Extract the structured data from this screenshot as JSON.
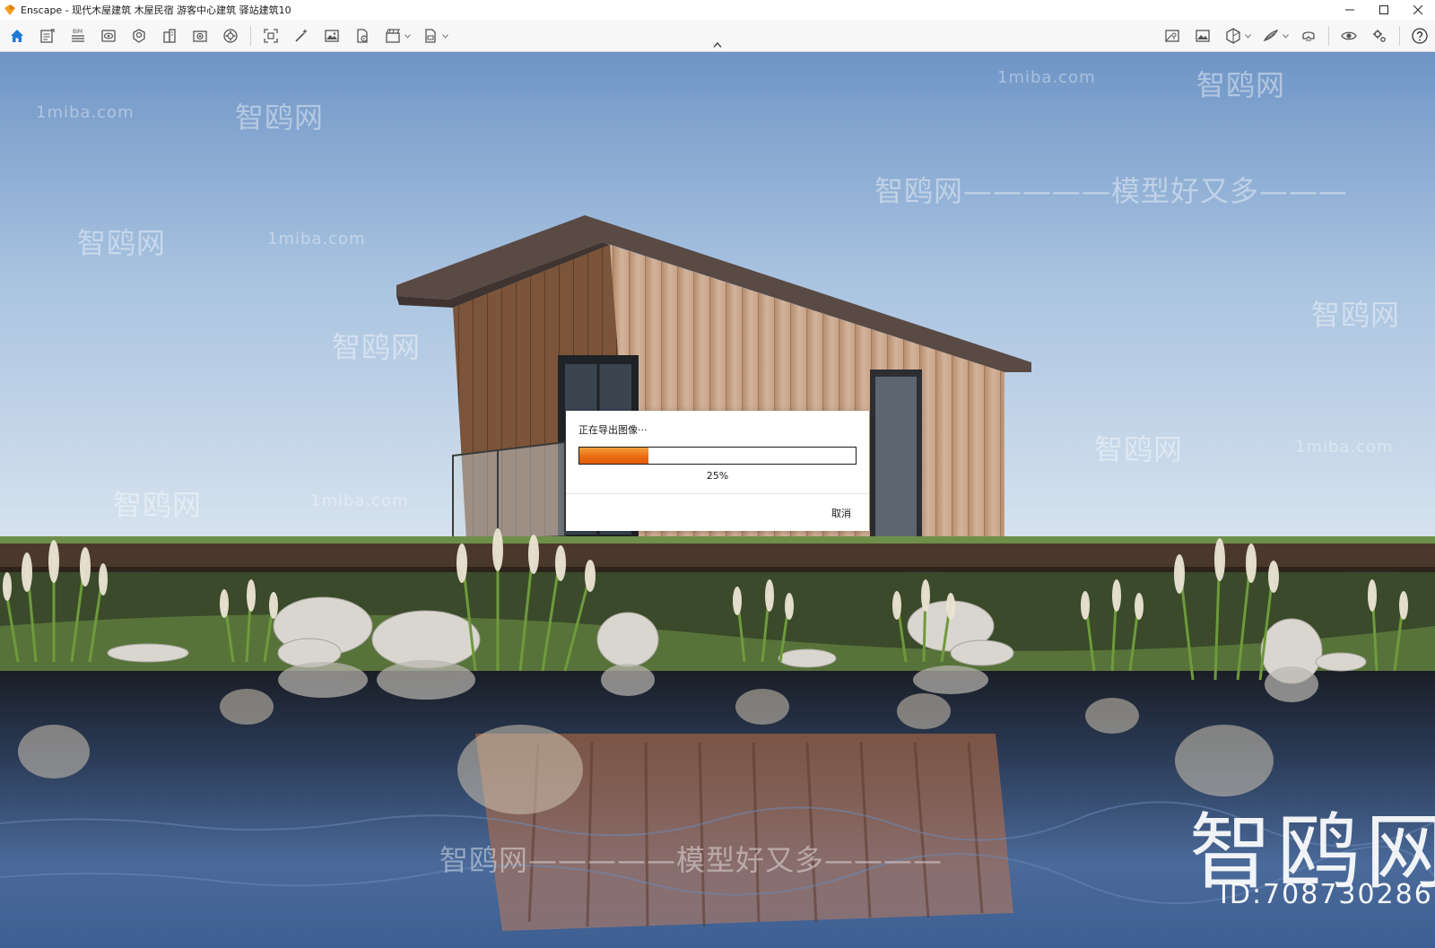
{
  "window": {
    "title": "Enscape - 现代木屋建筑 木屋民宿 游客中心建筑 驿站建筑10",
    "accent_color": "#1d7ad6"
  },
  "toolbar": {
    "left_icons": [
      "home-icon",
      "capture-icon",
      "bim-icon",
      "view-icon",
      "atmosphere-icon",
      "buildings-icon",
      "asset-library-icon",
      "materials-icon",
      "fit-view-icon",
      "magic-wand-icon",
      "image-export-icon",
      "batch-export-icon",
      "video-icon",
      "panorama-export-icon"
    ],
    "bim_label": "BIM",
    "right_icons": [
      "map-icon",
      "gallery-icon",
      "section-icon",
      "sketch-icon",
      "vr-icon",
      "visibility-icon",
      "settings-icon",
      "help-icon"
    ]
  },
  "watermarks": {
    "site": "1miba.com",
    "brand": "智鸥网",
    "slogan": "智鸥网—————模型好又多———",
    "slogan_bottom": "智鸥网—————模型好又多————",
    "logo": "智鸥网",
    "id_text": "ID:708730286"
  },
  "export_dialog": {
    "title": "正在导出图像···",
    "progress_percent": 25,
    "progress_label": "25%",
    "cancel_label": "取消"
  }
}
